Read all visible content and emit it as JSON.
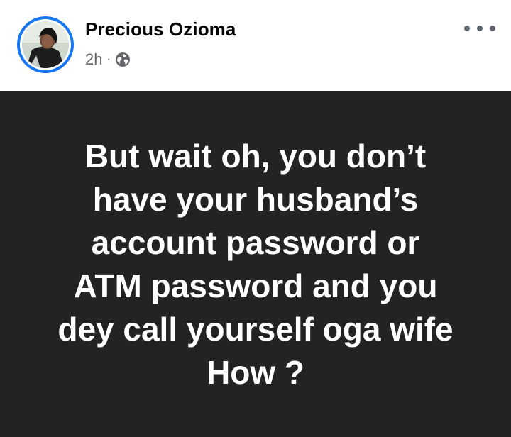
{
  "author": {
    "name": "Precious Ozioma",
    "time": "2h",
    "separator": "·",
    "audience_icon": "globe-icon"
  },
  "header": {
    "more_icon": "more-horizontal-icon"
  },
  "post": {
    "background_color": "#232323",
    "text_color": "#ffffff",
    "lines": [
      "But wait oh, you don’t",
      "have your husband’s",
      "account password or",
      "ATM password and you",
      "dey call yourself oga wife",
      "How ?"
    ]
  },
  "colors": {
    "avatar_ring": "#1877f2",
    "meta_text": "#65676b"
  }
}
